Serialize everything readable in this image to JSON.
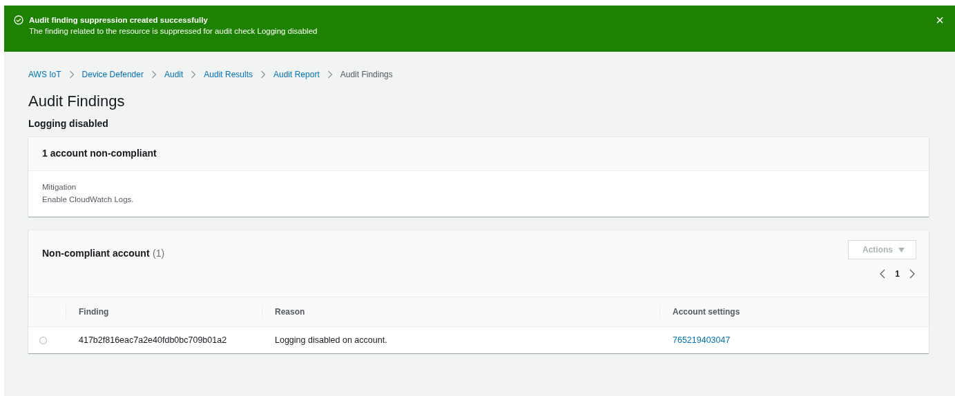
{
  "flash": {
    "title": "Audit finding suppression created successfully",
    "message": "The finding related to the resource is suppressed for audit check Logging disabled",
    "close": "×"
  },
  "breadcrumbs": [
    {
      "label": "AWS IoT",
      "current": false
    },
    {
      "label": "Device Defender",
      "current": false
    },
    {
      "label": "Audit",
      "current": false
    },
    {
      "label": "Audit Results",
      "current": false
    },
    {
      "label": "Audit Report",
      "current": false
    },
    {
      "label": "Audit Findings",
      "current": true
    }
  ],
  "page_title": "Audit Findings",
  "subtitle": "Logging disabled",
  "summary": {
    "title": "1 account non-compliant",
    "mitigation_label": "Mitigation",
    "mitigation": "Enable CloudWatch Logs."
  },
  "table": {
    "title": "Non-compliant account",
    "count": "(1)",
    "actions": {
      "label": "Actions",
      "disabled": true
    },
    "page": "1",
    "columns": [
      "Finding",
      "Reason",
      "Account settings"
    ],
    "rows": [
      {
        "selected": false,
        "finding": "417b2f816eac7a2e40fdb0bc709b01a2",
        "reason": "Logging disabled on account.",
        "account": "765219403047"
      }
    ]
  }
}
